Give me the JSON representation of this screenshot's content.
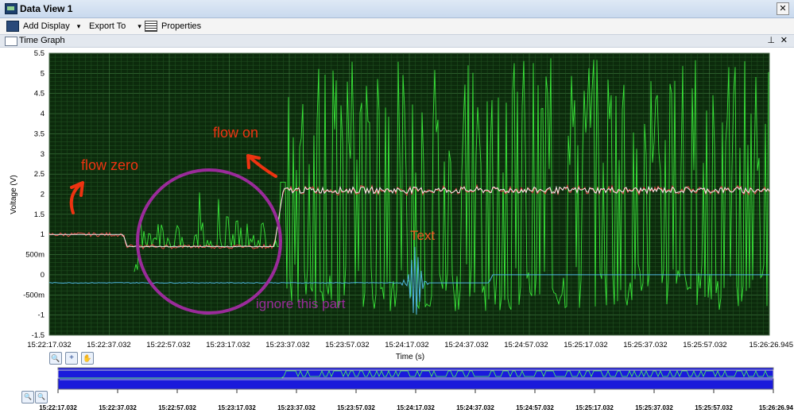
{
  "window": {
    "title": "Data View 1",
    "close_glyph": "✕"
  },
  "toolbar": {
    "add_display": "Add Display",
    "export_to": "Export To",
    "properties": "Properties",
    "dropdown_glyph": "▾"
  },
  "panel": {
    "title": "Time Graph",
    "pin_glyph": "⊥",
    "close_glyph": "✕"
  },
  "chart_data": {
    "type": "line",
    "ylabel": "Voltage (V)",
    "xlabel": "Time (s)",
    "ylim": [
      -1.5,
      5.5
    ],
    "yticks": [
      "5.5",
      "5",
      "4.5",
      "4",
      "3.5",
      "3",
      "2.5",
      "2",
      "1.5",
      "1",
      "500m",
      "0",
      "-500m",
      "-1",
      "-1.5"
    ],
    "xticks": [
      "15:22:17.032",
      "15:22:37.032",
      "15:22:57.032",
      "15:23:17.032",
      "15:23:37.032",
      "15:23:57.032",
      "15:24:17.032",
      "15:24:37.032",
      "15:24:57.032",
      "15:25:17.032",
      "15:25:37.032",
      "15:25:57.032",
      "15:26:26.945"
    ],
    "overview_ticks": [
      "15:22:17.032",
      "15:22:37.032",
      "15:22:57.032",
      "15:23:17.032",
      "15:23:37.032",
      "15:23:57.032",
      "15:24:17.032",
      "15:24:37.032",
      "15:24:57.032",
      "15:25:17.032",
      "15:25:37.032",
      "15:25:57.032",
      "15:26:26.94"
    ],
    "grid": true,
    "background": "#0c2a0c",
    "series_colors": {
      "green": "#39e639",
      "white": "#f2f2f2",
      "red": "#e04040",
      "blue": "#4fb6e0"
    },
    "series": [
      {
        "color": "#39e639",
        "description": "oscillating signal"
      },
      {
        "color": "#f2f2f2",
        "description": "level ~1 V then ~0.7 V then ~2.1 V"
      },
      {
        "color": "#4fb6e0",
        "description": "baseline ~-0.2 V stepping to ~0 V"
      }
    ]
  },
  "annotations": {
    "flow_zero": "flow zero",
    "flow_on": "flow on",
    "ignore": "ignore this part",
    "text": "Text",
    "color_red": "#ee3311",
    "color_purple": "#9a2b9a"
  },
  "nav": {
    "zoom_glyph": "🔍",
    "plus_glyph": "+",
    "hand_glyph": "✋"
  }
}
